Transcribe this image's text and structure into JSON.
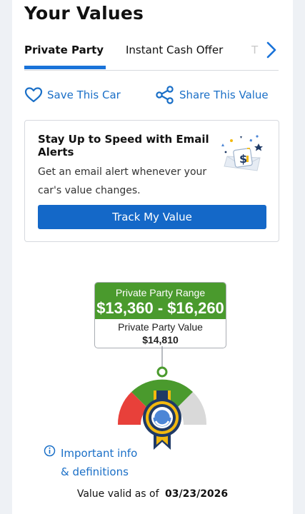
{
  "page": {
    "title": "Your Values"
  },
  "tabs": [
    {
      "label": "Private Party",
      "active": true
    },
    {
      "label": "Instant Cash Offer",
      "active": false
    },
    {
      "label": "T",
      "active": false
    }
  ],
  "actions": {
    "save_label": "Save This Car",
    "share_label": "Share This Value"
  },
  "alert_card": {
    "title": "Stay Up to Speed with Email Alerts",
    "text": "Get an email alert whenever your car's value changes.",
    "button_label": "Track My Value"
  },
  "valuation": {
    "range_label": "Private Party Range",
    "range_value": "$13,360 - $16,260",
    "value_label": "Private Party Value",
    "value": "$14,810"
  },
  "info_link": {
    "line1": "Important info",
    "line2": "& definitions"
  },
  "valid": {
    "prefix": "Value valid as of",
    "date": "03/23/2026"
  },
  "colors": {
    "accent": "#1a73d9",
    "button": "#1468c8",
    "range_green": "#4a9a2d",
    "gauge_red": "#e8403a",
    "gauge_green": "#4a9a2d",
    "gauge_gray": "#d9d9d9",
    "ribbon_navy": "#1f3a66",
    "ribbon_gold": "#f2b90f"
  }
}
